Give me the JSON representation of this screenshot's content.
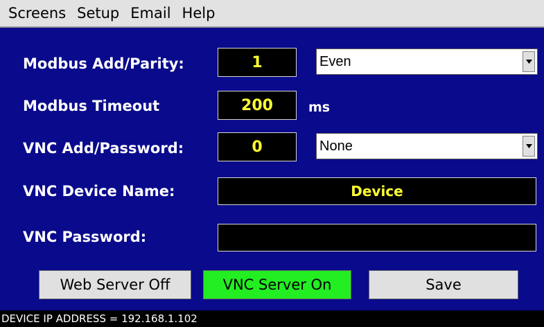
{
  "menu": {
    "items": [
      "Screens",
      "Setup",
      "Email",
      "Help"
    ]
  },
  "fields": {
    "modbus_addr_parity": {
      "label": "Modbus Add/Parity:",
      "value": "1",
      "option": "Even"
    },
    "modbus_timeout": {
      "label": "Modbus Timeout",
      "value": "200",
      "unit": "ms"
    },
    "vnc_addr_password": {
      "label": "VNC Add/Password:",
      "value": "0",
      "option": "None"
    },
    "vnc_device_name": {
      "label": "VNC Device Name:",
      "value": "Device"
    },
    "vnc_password": {
      "label": "VNC Password:",
      "value": ""
    }
  },
  "buttons": {
    "web_server": {
      "label": "Web Server Off",
      "color": "#e0e0e0"
    },
    "vnc_server": {
      "label": "VNC Server On",
      "color": "#22ee22"
    },
    "save": {
      "label": "Save",
      "color": "#e0e0e0"
    }
  },
  "status": {
    "text": "DEVICE IP ADDRESS = 192.168.1.102"
  },
  "colors": {
    "panel_bg": "#0a0a8c",
    "field_text": "#ffff33",
    "field_bg": "#000000"
  }
}
